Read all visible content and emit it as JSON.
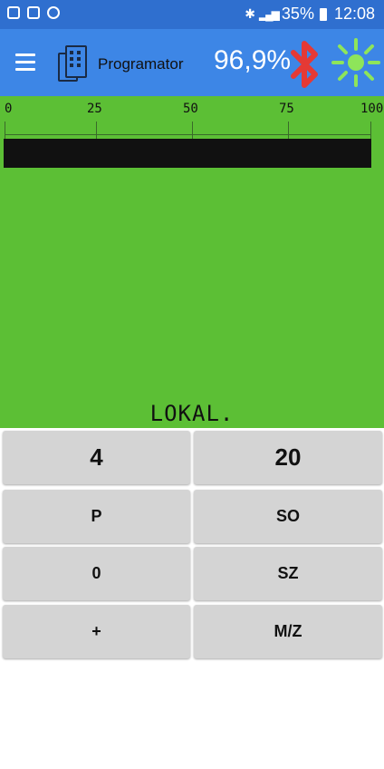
{
  "statusbar": {
    "left_icons": [
      "image-icon",
      "voicemail-icon",
      "sync-icon"
    ],
    "right_icons": [
      "bluetooth-icon",
      "signal-icon",
      "battery-icon"
    ],
    "battery": "35%",
    "time": "12:08"
  },
  "appbar": {
    "title": "Programator",
    "percent": "96,9%",
    "icons": [
      "menu-icon",
      "programmer-icon",
      "bluetooth-icon",
      "sun-icon"
    ],
    "colors": {
      "background": "#3d86e6",
      "bluetooth": "#e53935",
      "sun": "#8ee55a"
    }
  },
  "meter": {
    "ticks": [
      "0",
      "25",
      "50",
      "75",
      "100"
    ],
    "level_percent": 100,
    "mode": "LOKAL.",
    "colors": {
      "background": "#5cbf35",
      "bar": "#111111"
    }
  },
  "keypad": {
    "rows": [
      [
        "4",
        "20"
      ],
      [
        "P",
        "SO"
      ],
      [
        "0",
        "SZ"
      ],
      [
        "+",
        "M/Z"
      ]
    ]
  }
}
